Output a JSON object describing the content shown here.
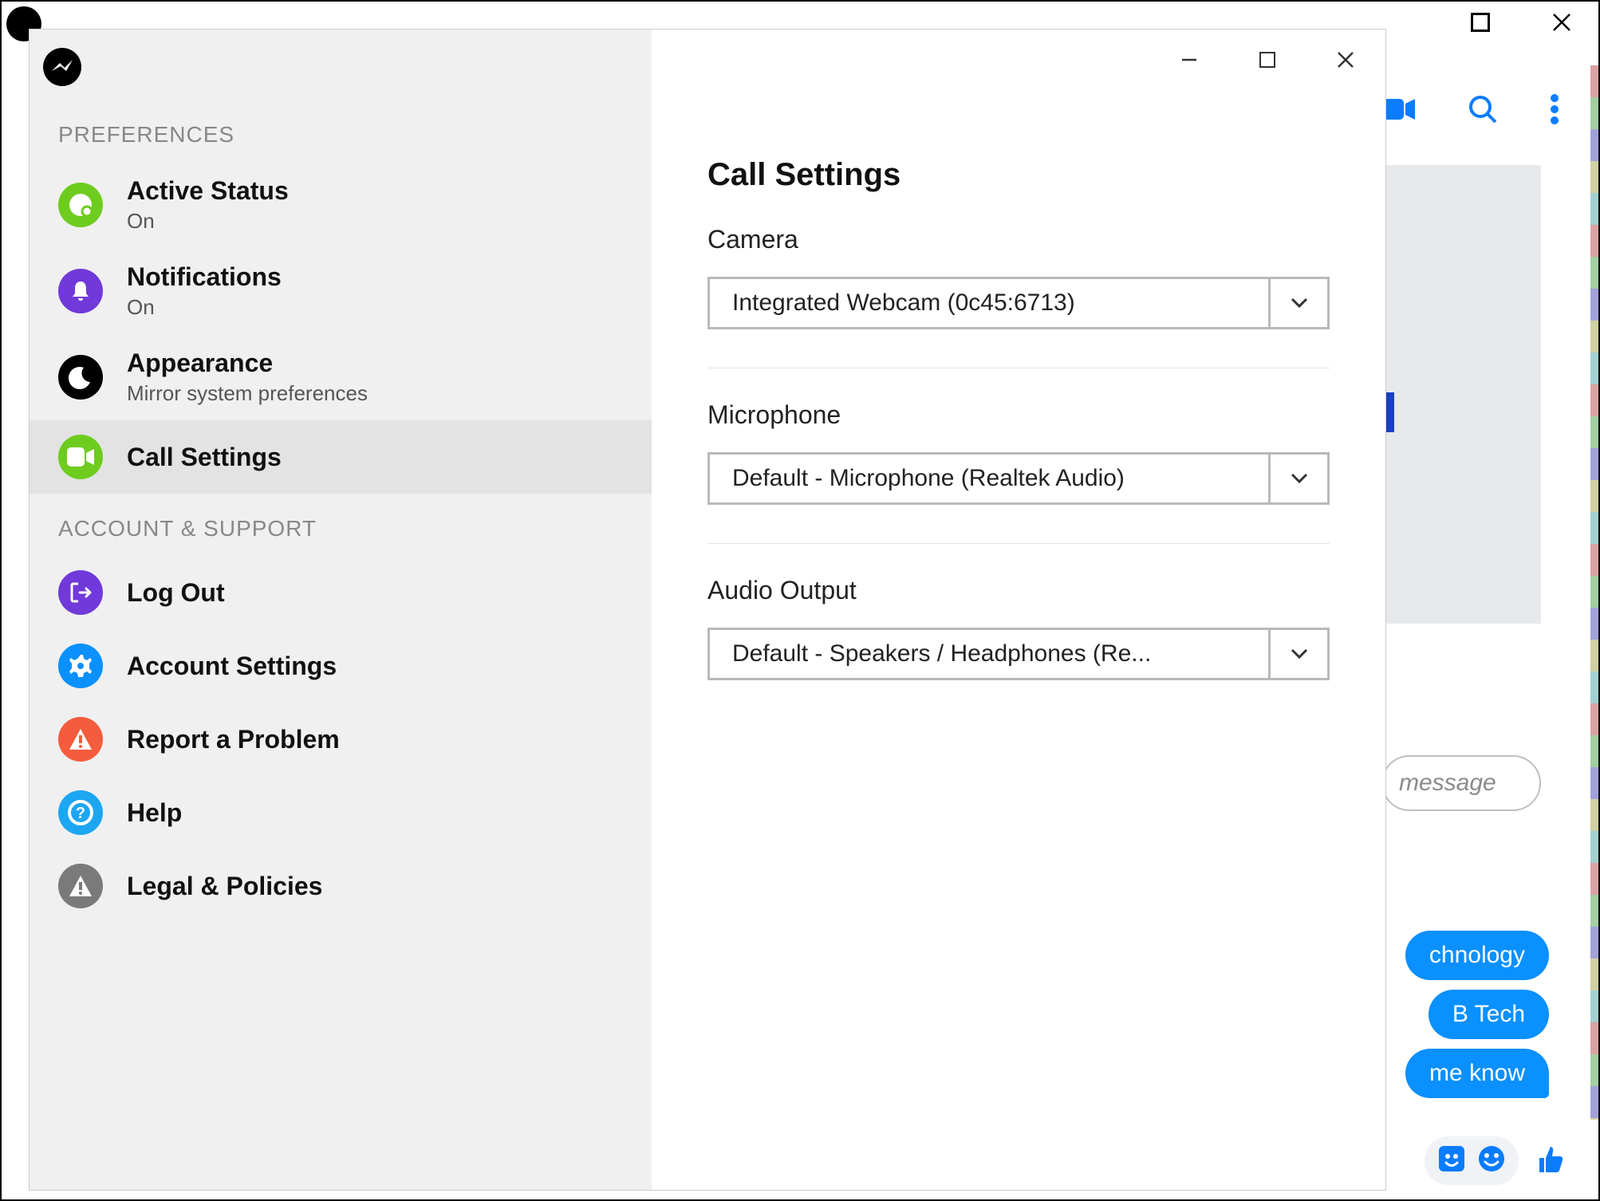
{
  "bg": {
    "messageInputPlaceholder": "message",
    "bubbles": [
      "chnology",
      "B Tech",
      "me know"
    ]
  },
  "dialog": {
    "sidebar": {
      "section1": "PREFERENCES",
      "section2": "ACCOUNT & SUPPORT",
      "items": {
        "activeStatus": {
          "title": "Active Status",
          "sub": "On"
        },
        "notifications": {
          "title": "Notifications",
          "sub": "On"
        },
        "appearance": {
          "title": "Appearance",
          "sub": "Mirror system preferences"
        },
        "callSettings": {
          "title": "Call Settings"
        },
        "logout": {
          "title": "Log Out"
        },
        "accountSettings": {
          "title": "Account Settings"
        },
        "report": {
          "title": "Report a Problem"
        },
        "help": {
          "title": "Help"
        },
        "legal": {
          "title": "Legal & Policies"
        }
      }
    },
    "content": {
      "title": "Call Settings",
      "camera": {
        "label": "Camera",
        "value": "Integrated Webcam (0c45:6713)"
      },
      "mic": {
        "label": "Microphone",
        "value": "Default - Microphone (Realtek Audio)"
      },
      "output": {
        "label": "Audio Output",
        "value": "Default - Speakers / Headphones (Re..."
      }
    }
  }
}
